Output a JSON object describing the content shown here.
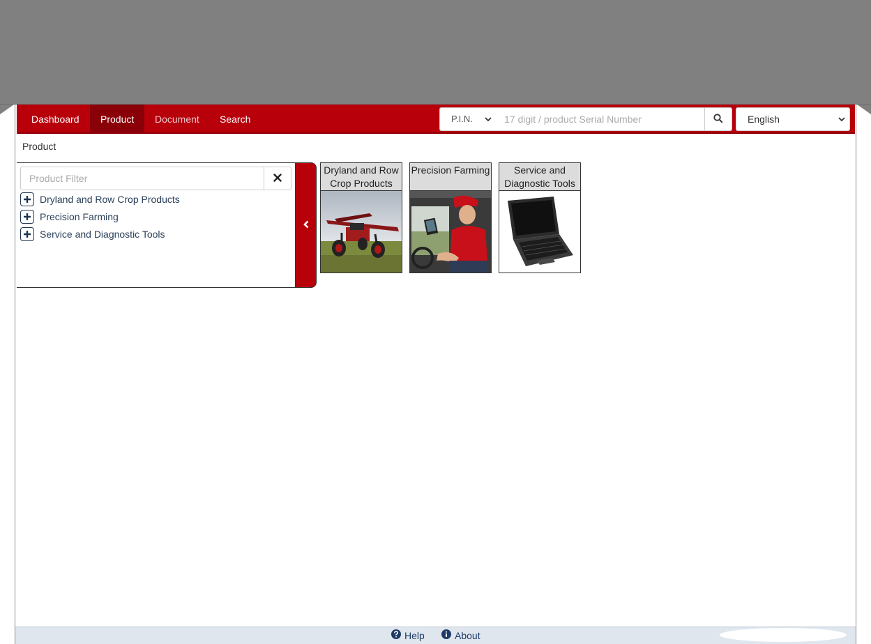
{
  "nav": {
    "items": [
      {
        "label": "Dashboard"
      },
      {
        "label": "Product"
      },
      {
        "label": "Document"
      },
      {
        "label": "Search"
      }
    ],
    "active": "Product"
  },
  "search": {
    "type_value": "P.I.N.",
    "serial_placeholder": "17 digit / product Serial Number",
    "search_icon": "search-icon"
  },
  "language": {
    "value": "English"
  },
  "breadcrumb": {
    "current": "Product"
  },
  "tree": {
    "filter_placeholder": "Product Filter",
    "clear_icon": "close-icon",
    "items": [
      {
        "label": "Dryland and Row Crop Products"
      },
      {
        "label": "Precision Farming"
      },
      {
        "label": "Service and Diagnostic Tools"
      }
    ]
  },
  "cards": [
    {
      "title": "Dryland and Row Crop Products"
    },
    {
      "title": "Precision Farming"
    },
    {
      "title": "Service and Diagnostic Tools"
    }
  ],
  "footer": {
    "help": "Help",
    "about": "About"
  },
  "colors": {
    "navbar": "#b8000b",
    "nav_active": "#8a0008",
    "footer_bg": "#dfe6ee",
    "link": "#1d3b66"
  }
}
